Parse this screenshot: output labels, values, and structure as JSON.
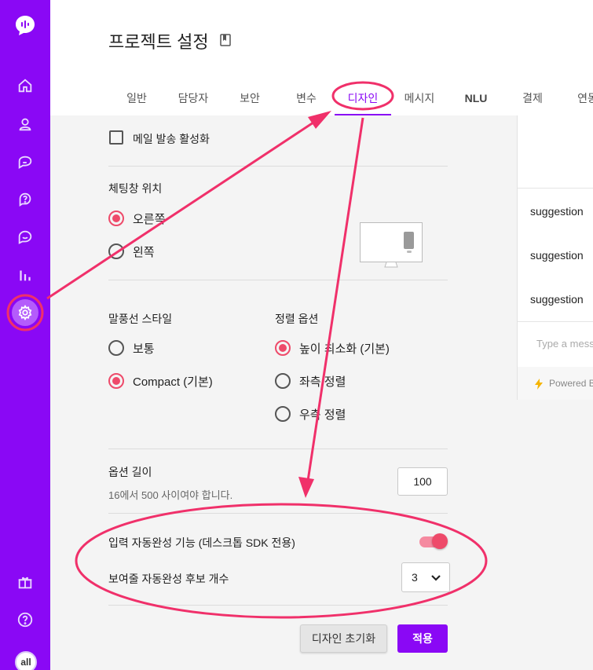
{
  "page": {
    "title": "프로젝트 설정"
  },
  "sidebar": {
    "avatar_text": "all",
    "icons": [
      "logo-icon",
      "home-icon",
      "user-icon",
      "chat-icon",
      "help-icon",
      "chat-smile-icon",
      "bar-chart-icon",
      "gear-icon",
      "gift-icon",
      "question-icon"
    ]
  },
  "tabs": [
    "일반",
    "담당자",
    "보안",
    "변수",
    "디자인",
    "메시지",
    "NLU",
    "결제",
    "연동"
  ],
  "active_tab": "디자인",
  "form": {
    "email_checkbox": "메일 발송 활성화",
    "chat_position": {
      "label": "체팅창 위치",
      "options": [
        "오른쪽",
        "왼쪽"
      ],
      "selected": "오른쪽"
    },
    "bubble_style": {
      "label": "말풍선 스타일",
      "options": [
        "보통",
        "Compact (기본)"
      ],
      "selected": "Compact (기본)"
    },
    "align": {
      "label": "정렬 옵션",
      "options": [
        "높이 최소화 (기본)",
        "좌측 정렬",
        "우측 정렬"
      ],
      "selected": "높이 최소화 (기본)"
    },
    "option_length": {
      "label": "옵션 길이",
      "hint": "16에서 500 사이여야 합니다.",
      "value": "100"
    },
    "autocomplete": {
      "label": "입력 자동완성 기능 (데스크톱 SDK 전용)",
      "enabled": true
    },
    "autocomplete_count": {
      "label": "보여줄 자동완성 후보 개수",
      "value": "3"
    },
    "buttons": {
      "reset": "디자인 초기화",
      "apply": "적용"
    }
  },
  "preview": {
    "suggestions": [
      "suggestion",
      "suggestion",
      "suggestion"
    ],
    "input_placeholder": "Type a mess",
    "powered": "Powered B"
  },
  "colors": {
    "brand": "#8a08f5",
    "accent": "#ee4a6a",
    "annotation": "#f0306a"
  }
}
